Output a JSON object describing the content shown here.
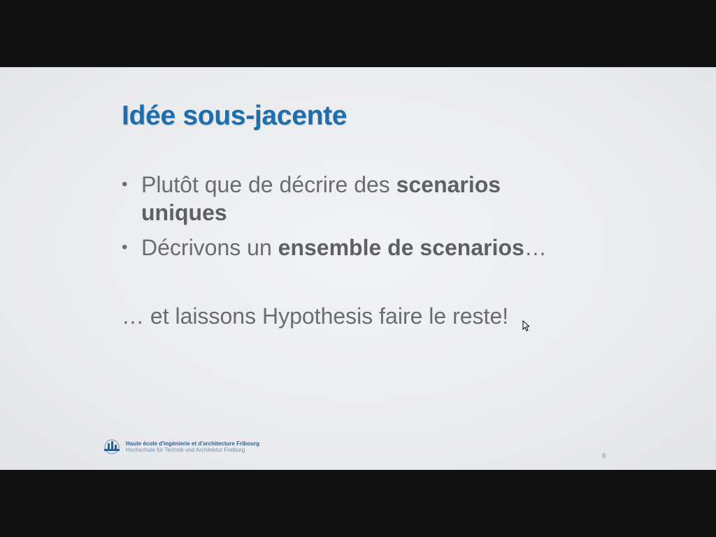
{
  "slide": {
    "title": "Idée sous-jacente",
    "bullets": [
      {
        "parts": [
          {
            "text": "Plutôt que de décrire des ",
            "bold": false
          },
          {
            "text": "scenarios uniques",
            "bold": true
          }
        ]
      },
      {
        "parts": [
          {
            "text": "Décrivons un ",
            "bold": false
          },
          {
            "text": "ensemble de scenarios",
            "bold": true
          },
          {
            "text": "…",
            "bold": false
          }
        ]
      }
    ],
    "tagline": "… et laissons Hypothesis faire le reste!",
    "page_number": "6"
  },
  "footer": {
    "institution_fr": "Haute école d'ingénierie et d'architecture Fribourg",
    "institution_de": "Hochschule für Technik und Architektur Freiburg"
  },
  "colors": {
    "title": "#1b6fae",
    "body_text": "#6a6c70",
    "letterbox": "#111111"
  },
  "icons": {
    "bullet": "bullet-dot",
    "logo": "heia-fr-logo",
    "cursor": "mouse-pointer-icon"
  }
}
